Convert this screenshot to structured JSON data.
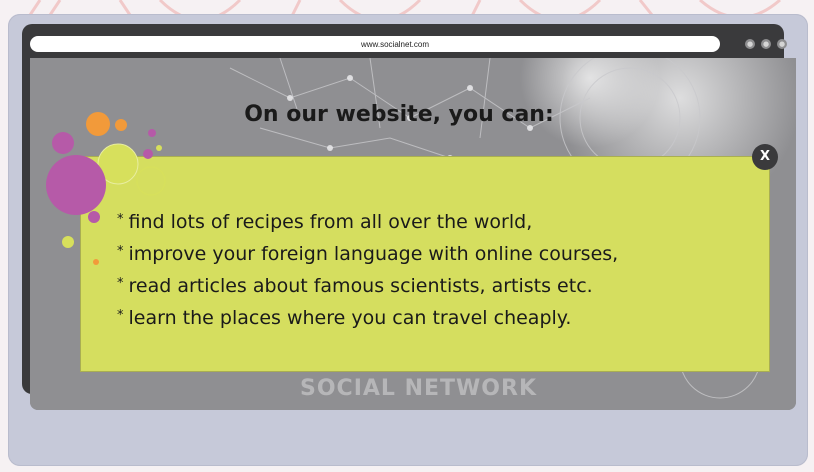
{
  "browser": {
    "url": "www.socialnet.com",
    "window_buttons": [
      "minimize-icon",
      "maximize-icon",
      "close-window-icon"
    ]
  },
  "page": {
    "headline": "On our website, you can:",
    "watermark": "SOCIAL NETWORK"
  },
  "dialog": {
    "close_label": "X",
    "bullet": "*",
    "items": [
      "find lots of recipes from all over the world,",
      "improve your foreign language with online courses,",
      "read articles about famous scientists, artists etc.",
      "learn the places where you can travel cheaply."
    ]
  },
  "colors": {
    "dialog_bg": "#d5de5f",
    "screen_frame": "#3a3a3c",
    "monitor": "#c6c9d9",
    "bubble_purple": "#b65aa8",
    "bubble_orange": "#f29a3a",
    "bubble_lime": "#d7e05c"
  }
}
